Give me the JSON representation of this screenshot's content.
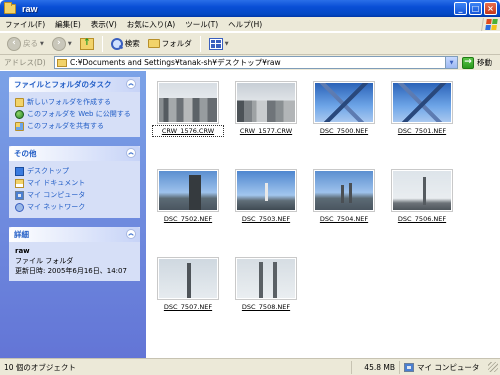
{
  "window": {
    "title": "raw"
  },
  "menu": {
    "items": [
      "ファイル(F)",
      "編集(E)",
      "表示(V)",
      "お気に入り(A)",
      "ツール(T)",
      "ヘルプ(H)"
    ]
  },
  "toolbar": {
    "back": "戻る",
    "search": "検索",
    "folders": "フォルダ"
  },
  "address": {
    "label": "アドレス(D)",
    "path": "C:¥Documents and Settings¥tanak-sh¥デスクトップ¥raw",
    "go": "移動"
  },
  "tasks_panel": {
    "title": "ファイルとフォルダのタスク",
    "items": [
      "新しいフォルダを作成する",
      "このフォルダを Web に公開する",
      "このフォルダを共有する"
    ]
  },
  "other_panel": {
    "title": "その他",
    "items": [
      "デスクトップ",
      "マイ ドキュメント",
      "マイ コンピュータ",
      "マイ ネットワーク"
    ]
  },
  "details_panel": {
    "title": "詳細",
    "name": "raw",
    "type": "ファイル フォルダ",
    "modified": "更新日時: 2005年6月16日、14:07"
  },
  "files": [
    {
      "name": "CRW_1576.CRW",
      "kind": "city"
    },
    {
      "name": "CRW_1577.CRW",
      "kind": "city2"
    },
    {
      "name": "DSC_7500.NEF",
      "kind": "pyramid"
    },
    {
      "name": "DSC_7501.NEF",
      "kind": "pyramid"
    },
    {
      "name": "DSC_7502.NEF",
      "kind": "tower"
    },
    {
      "name": "DSC_7503.NEF",
      "kind": "chimney"
    },
    {
      "name": "DSC_7504.NEF",
      "kind": "chimneys"
    },
    {
      "name": "DSC_7506.NEF",
      "kind": "tower2"
    },
    {
      "name": "DSC_7507.NEF",
      "kind": "lattice"
    },
    {
      "name": "DSC_7508.NEF",
      "kind": "stacks"
    }
  ],
  "status": {
    "objects": "10 個のオブジェクト",
    "size": "45.8 MB",
    "location": "マイ コンピュータ"
  },
  "colors": {
    "titlebar": "#0a4fd6",
    "taskpane": "#6f8fe0",
    "link": "#215dc6",
    "chrome": "#ece9d8"
  }
}
